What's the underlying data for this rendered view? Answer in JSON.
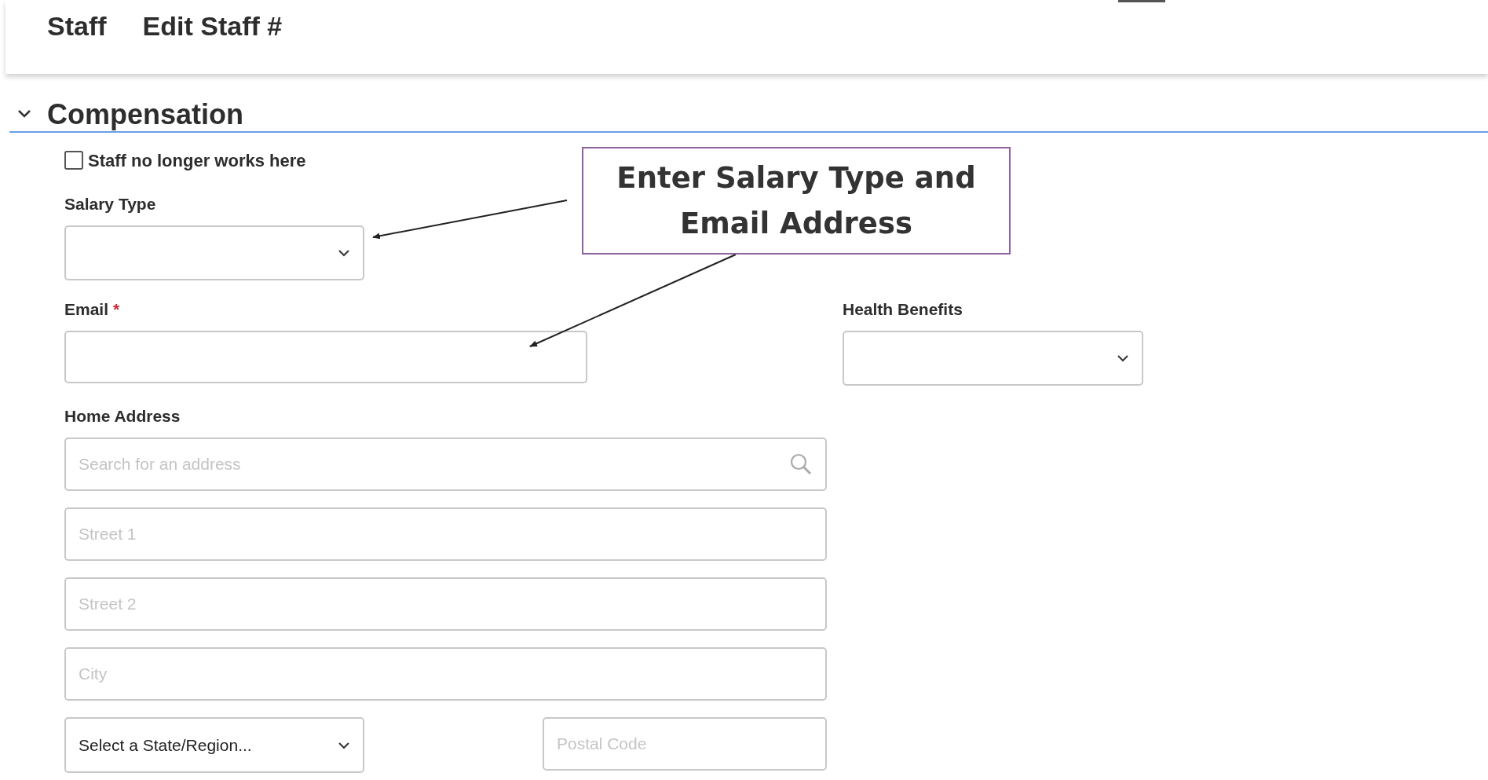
{
  "header": {
    "title": "Staff",
    "subtitle": "Edit Staff #"
  },
  "section": {
    "title": "Compensation",
    "expanded": true
  },
  "no_longer_works": {
    "label": "Staff no longer works here",
    "checked": false
  },
  "salary_type": {
    "label": "Salary Type"
  },
  "email": {
    "label": "Email",
    "required_mark": "*"
  },
  "health_benefits": {
    "label": "Health Benefits"
  },
  "home_address": {
    "label": "Home Address",
    "search_placeholder": "Search for an address",
    "street1_placeholder": "Street 1",
    "street2_placeholder": "Street 2",
    "city_placeholder": "City",
    "state_value": "Select a State/Region...",
    "postal_placeholder": "Postal Code"
  },
  "callout": {
    "lines": [
      "Enter Salary Type and",
      "Email Address"
    ]
  }
}
